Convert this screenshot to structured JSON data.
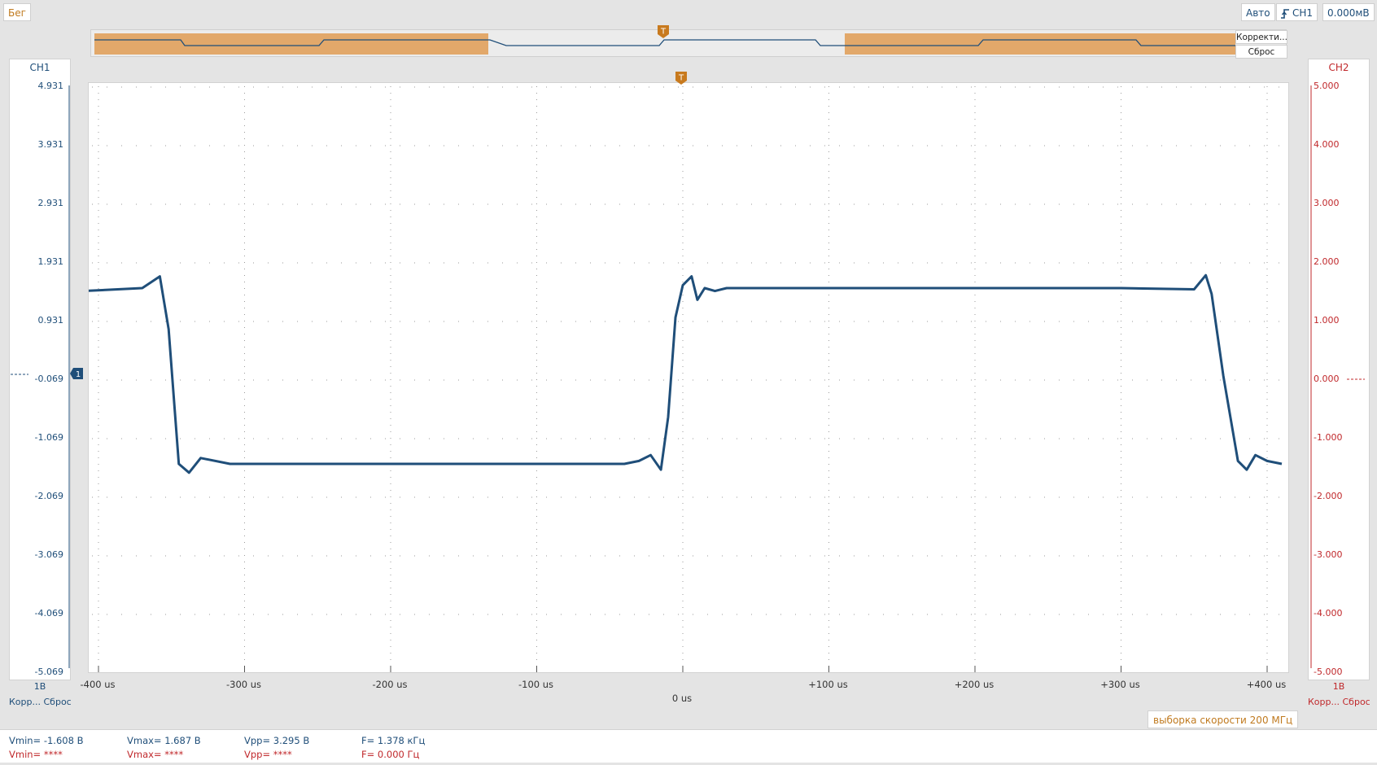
{
  "toolbar": {
    "run_label": "Бег",
    "mode_label": "Авто",
    "trigger_source": "CH1",
    "trigger_level": "0.000мВ"
  },
  "overview": {
    "correct_label": "Корректи...",
    "reset_label": "Сброс",
    "trigger_marker": "T"
  },
  "ch1": {
    "title": "CH1",
    "ticks": [
      "4.931",
      "3.931",
      "2.931",
      "1.931",
      "0.931",
      "-0.069",
      "-1.069",
      "-2.069",
      "-3.069",
      "-4.069",
      "-5.069"
    ],
    "scale": "1В",
    "footer": "Корр... Сброс",
    "marker": "1",
    "color": "#1f4e79"
  },
  "ch2": {
    "title": "CH2",
    "ticks": [
      "5.000",
      "4.000",
      "3.000",
      "2.000",
      "1.000",
      "0.000",
      "-1.000",
      "-2.000",
      "-3.000",
      "-4.000",
      "-5.000"
    ],
    "scale": "1В",
    "footer": "Корр... Сброс",
    "color": "#c0282b"
  },
  "plot": {
    "trigger_marker": "T",
    "x_ticks": [
      "-400 us",
      "-300 us",
      "-200 us",
      "-100 us",
      "0 us",
      "+100 us",
      "+200 us",
      "+300 us",
      "+400 us"
    ]
  },
  "sample_rate": "выборка скорости 200 МГц",
  "measurements": {
    "ch1": {
      "vmin": "Vmin= -1.608 В",
      "vmax": "Vmax= 1.687 В",
      "vpp": "Vpp= 3.295 В",
      "freq": "F= 1.378 кГц"
    },
    "ch2": {
      "vmin": "Vmin= ****",
      "vmax": "Vmax= ****",
      "vpp": "Vpp= ****",
      "freq": "F= 0.000 Гц"
    }
  },
  "chart_data": {
    "type": "line",
    "series": [
      {
        "x": [
          -410,
          -370,
          -358,
          -352,
          -345,
          -338,
          -330,
          -310,
          -270,
          -200,
          -100,
          -40,
          -30,
          -22,
          -15,
          -10,
          -5,
          0,
          6,
          10,
          15,
          22,
          30,
          100,
          200,
          300,
          350,
          358,
          362,
          370,
          380,
          386,
          392,
          400,
          410
        ],
        "y": [
          1.45,
          1.5,
          1.7,
          0.8,
          -1.5,
          -1.65,
          -1.4,
          -1.5,
          -1.5,
          -1.5,
          -1.5,
          -1.5,
          -1.45,
          -1.35,
          -1.6,
          -0.7,
          1.0,
          1.55,
          1.7,
          1.3,
          1.5,
          1.45,
          1.5,
          1.5,
          1.5,
          1.5,
          1.48,
          1.72,
          1.4,
          0.0,
          -1.45,
          -1.6,
          -1.35,
          -1.45,
          -1.5
        ]
      }
    ],
    "xlim": [
      -410,
      410
    ],
    "ylim": [
      -5.069,
      4.931
    ],
    "grid": true
  }
}
